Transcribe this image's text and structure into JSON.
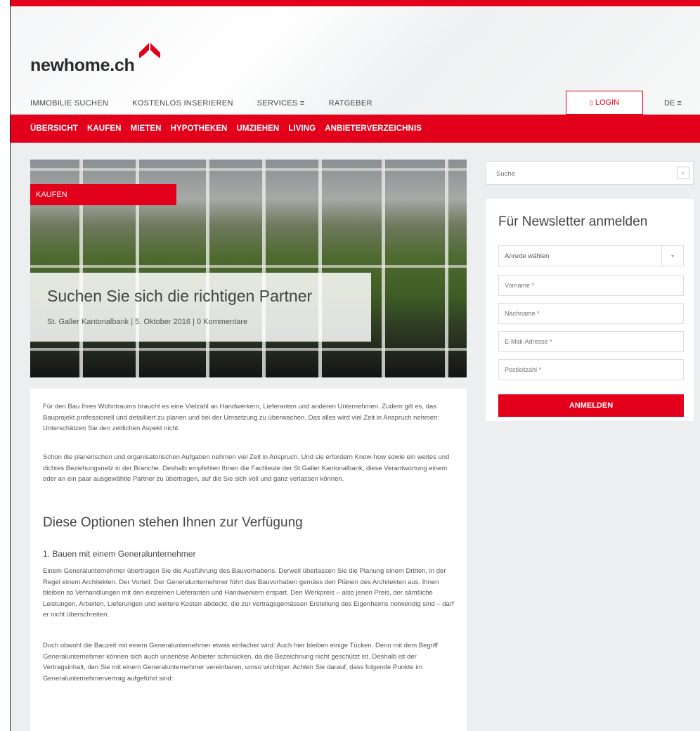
{
  "brand": {
    "logo_text": "newhome.ch",
    "accent": "#e2001a"
  },
  "nav": {
    "items": [
      "IMMOBILIE SUCHEN",
      "KOSTENLOS INSERIEREN",
      "SERVICES ≡",
      "RATGEBER"
    ],
    "login_label": "LOGIN",
    "language": "DE ≡"
  },
  "subnav": {
    "items": [
      "ÜBERSICHT",
      "KAUFEN",
      "MIETEN",
      "HYPOTHEKEN",
      "UMZIEHEN",
      "LIVING",
      "ANBIETERVERZEICHNIS"
    ]
  },
  "hero": {
    "tag": "KAUFEN",
    "title": "Suchen Sie sich die richtigen Partner",
    "byline": "St. Galler Kantonalbank | 5. Oktober 2016 | 0 Kommentare"
  },
  "article": {
    "p1": "Für den Bau Ihres Wohntraums braucht es eine Vielzahl an Handwerkern, Lieferanten und anderen Unternehmen. Zudem gilt es, das Bauprojekt professionell und detailliert zu planen und bei der Umsetzung zu überwachen. Das alles wird viel Zeit in Anspruch nehmen: Unterschätzen Sie den zeitlichen Aspekt nicht.",
    "p2": "Schon die planerischen und organisatorischen Aufgaben nehmen viel Zeit in Anspruch. Und sie erfordern Know-how sowie ein weites und dichtes Beziehungsnetz in der Branche. Deshalb empfehlen Ihnen die Fachleute der St.Galler Kantonalbank, diese Verantwortung einem oder an ein paar ausgewählte Partner zu übertragen, auf die Sie sich voll und ganz verlassen können.",
    "heading": "Diese Optionen stehen Ihnen zur Verfügung",
    "subheading": "1. Bauen mit einem Generalunternehmer",
    "p3": "Einem Generalunternehmer übertragen Sie die Ausführung des Bauvorhabens. Derweil überlassen Sie die Planung einem Dritten, in der Regel einem Architekten. Der Vorteil: Der Generalunternehmer führt das Bauvorhaben gemäss den Plänen des Architekten aus. Ihnen bleiben so Verhandlungen mit den einzelnen Lieferanten und Handwerkern erspart. Den Werkpreis – also jenen Preis, der sämtliche Leistungen, Arbeiten, Lieferungen und weitere Kosten abdeckt, die zur vertragsgemässen Erstellung des Eigenheims notwendig sind – darf er nicht überschreiten.",
    "p4": "Doch obwohl die Bauzeit mit einem Generalunternehmer etwas einfacher wird: Auch hier bleiben einige Tücken. Denn mit dem Begriff Generalunternehmer können sich auch unseriöse Anbieter schmücken, da die Bezeichnung nicht geschützt ist. Deshalb ist der Vertragsinhalt, den Sie mit einem Generalunternehmer vereinbaren, umso wichtiger. Achten Sie darauf, dass folgende Punkte im Generalunternehmervertrag aufgeführt sind:"
  },
  "sidebar": {
    "search_placeholder": "Suche",
    "newsletter_title": "Für Newsletter anmelden",
    "salutation": "Anrede wählen",
    "firstname_placeholder": "Vorname *",
    "lastname_placeholder": "Nachname *",
    "email_placeholder": "E-Mail-Adresse *",
    "zip_placeholder": "Postleitzahl *",
    "submit_label": "ANMELDEN"
  }
}
